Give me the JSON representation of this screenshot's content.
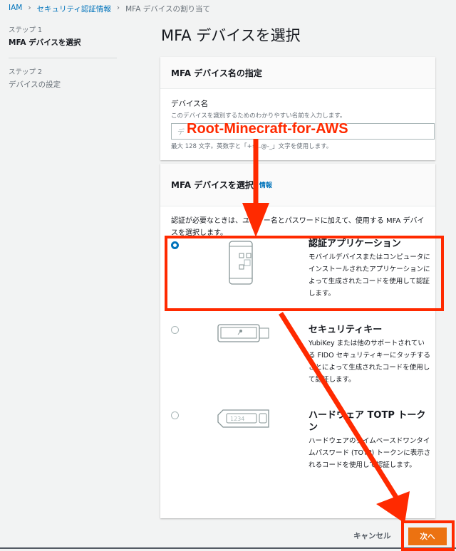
{
  "breadcrumb": [
    "IAM",
    "セキュリティ認証情報",
    "MFA デバイスの割り当て"
  ],
  "sidebar": {
    "step1_label": "ステップ 1",
    "step1_title": "MFA デバイスを選択",
    "step2_label": "ステップ 2",
    "step2_title": "デバイスの設定"
  },
  "page_title": "MFA デバイスを選択",
  "name_panel": {
    "title": "MFA デバイス名の指定",
    "field_label": "デバイス名",
    "field_hint": "このデバイスを識別するためのわかりやすい名前を入力します。",
    "placeholder": "デ",
    "constraint": "最大 128 文字。英数字と「+=,.@-_」文字を使用します。"
  },
  "device_panel": {
    "title": "MFA デバイスを選択",
    "info_link": "情報",
    "description": "認証が必要なときは、ユーザー名とパスワードに加えて、使用する MFA デバイスを選択します。",
    "options": [
      {
        "title": "認証アプリケーション",
        "description": "モバイルデバイスまたはコンピュータにインストールされたアプリケーションによって生成されたコードを使用して認証します。",
        "selected": true,
        "icon": "phone-qr-icon"
      },
      {
        "title": "セキュリティキー",
        "description": "YubiKey または他のサポートされている FIDO セキュリティキーにタッチすることによって生成されたコードを使用して認証します。",
        "selected": false,
        "icon": "usb-key-icon"
      },
      {
        "title": "ハードウェア TOTP トークン",
        "description": "ハードウェアのタイムベースドワンタイムパスワード (TOTP) トークンに表示されるコードを使用して認証します。",
        "selected": false,
        "icon": "totp-token-icon",
        "token_display": "1234"
      }
    ]
  },
  "footer": {
    "cancel": "キャンセル",
    "next": "次へ"
  },
  "annotation": {
    "text": "Root-Minecraft-for-AWS",
    "color": "#ff2a00"
  },
  "colors": {
    "accent": "#0073bb",
    "primary_button": "#ec7211"
  }
}
